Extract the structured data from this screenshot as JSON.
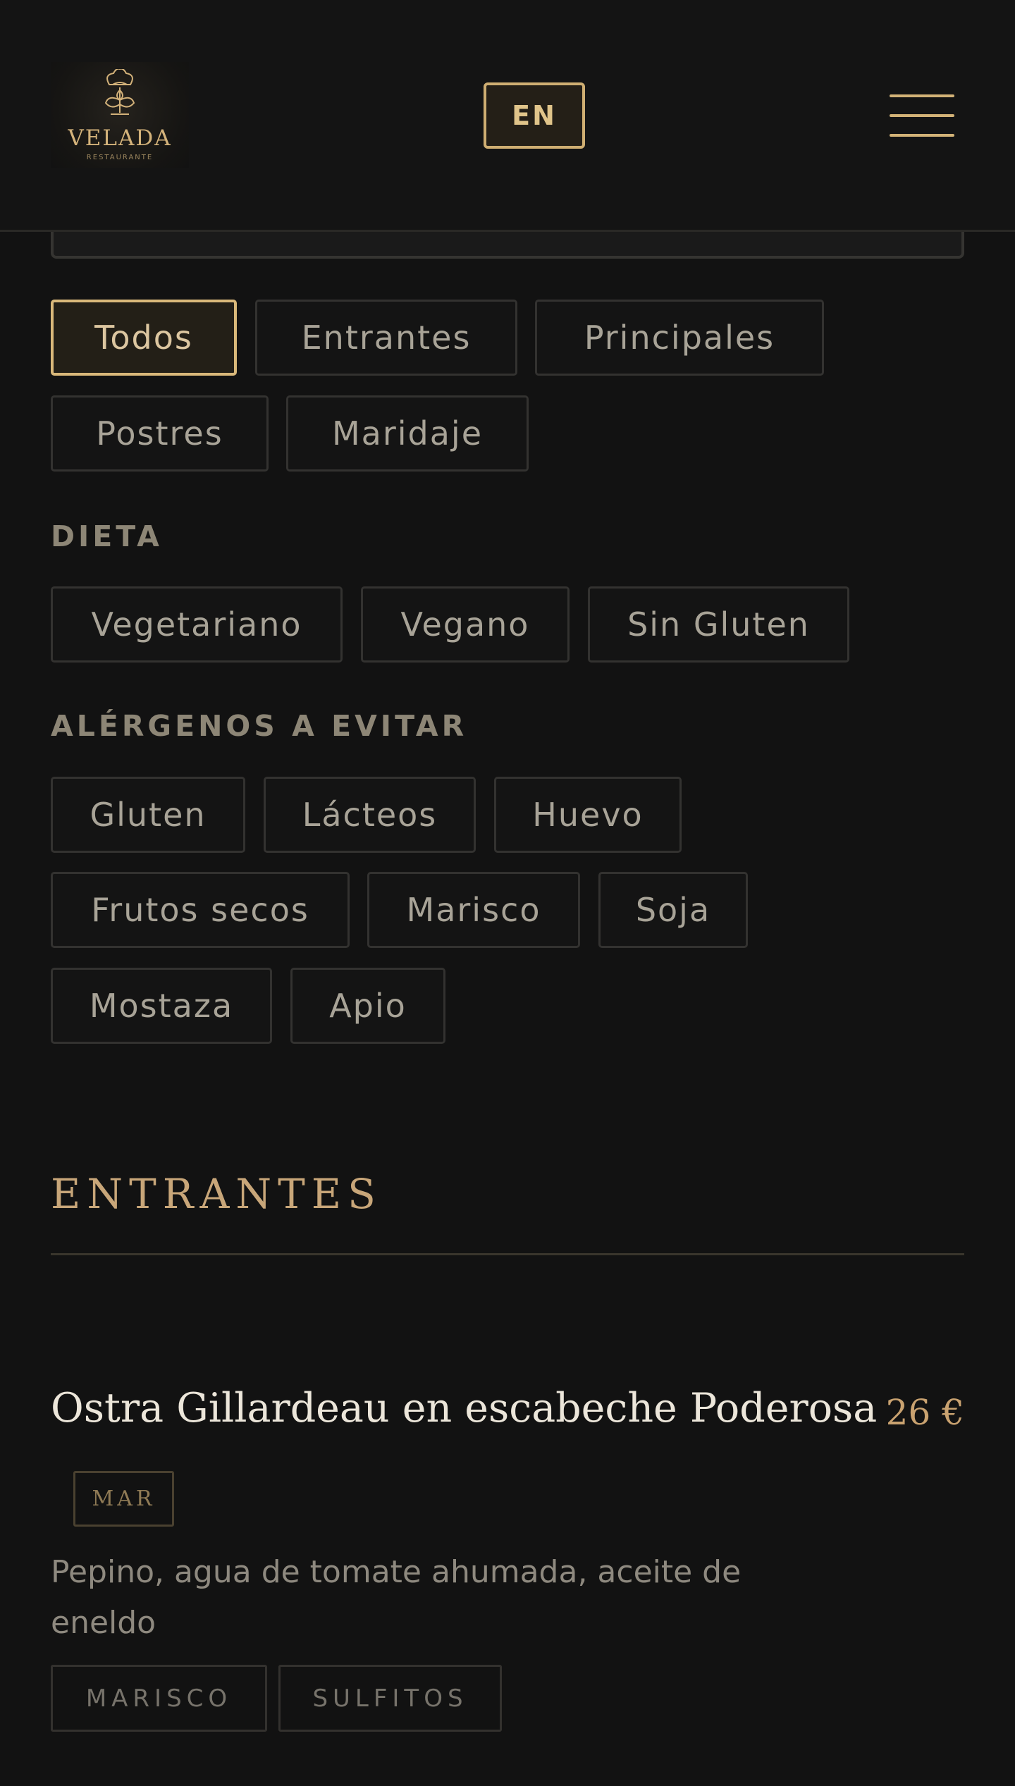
{
  "header": {
    "logo": {
      "name": "VELADA",
      "subtitle": "RESTAURANTE"
    },
    "language_button": "EN"
  },
  "filters": {
    "categories": [
      "Todos",
      "Entrantes",
      "Principales",
      "Postres",
      "Maridaje"
    ],
    "active_category": "Todos",
    "diet_label": "DIETA",
    "diet_options": [
      "Vegetariano",
      "Vegano",
      "Sin Gluten"
    ],
    "allergens_label": "ALÉRGENOS A EVITAR",
    "allergen_options": [
      "Gluten",
      "Lácteos",
      "Huevo",
      "Frutos secos",
      "Marisco",
      "Soja",
      "Mostaza",
      "Apio"
    ]
  },
  "section": {
    "title": "ENTRANTES",
    "dishes": [
      {
        "name": "Ostra Gillardeau en escabeche Poderosa",
        "price": "26 €",
        "origin_tag": "MAR",
        "description": "Pepino, agua de tomate ahumada, aceite de eneldo",
        "allergens": [
          "MARISCO",
          "SULFITOS"
        ]
      }
    ]
  },
  "colors": {
    "background": "#121212",
    "accent_gold": "#d2b277",
    "chip_border": "#333230"
  },
  "icons": {
    "logo": "flower-crown-logo-icon",
    "menu": "hamburger-menu-icon"
  }
}
